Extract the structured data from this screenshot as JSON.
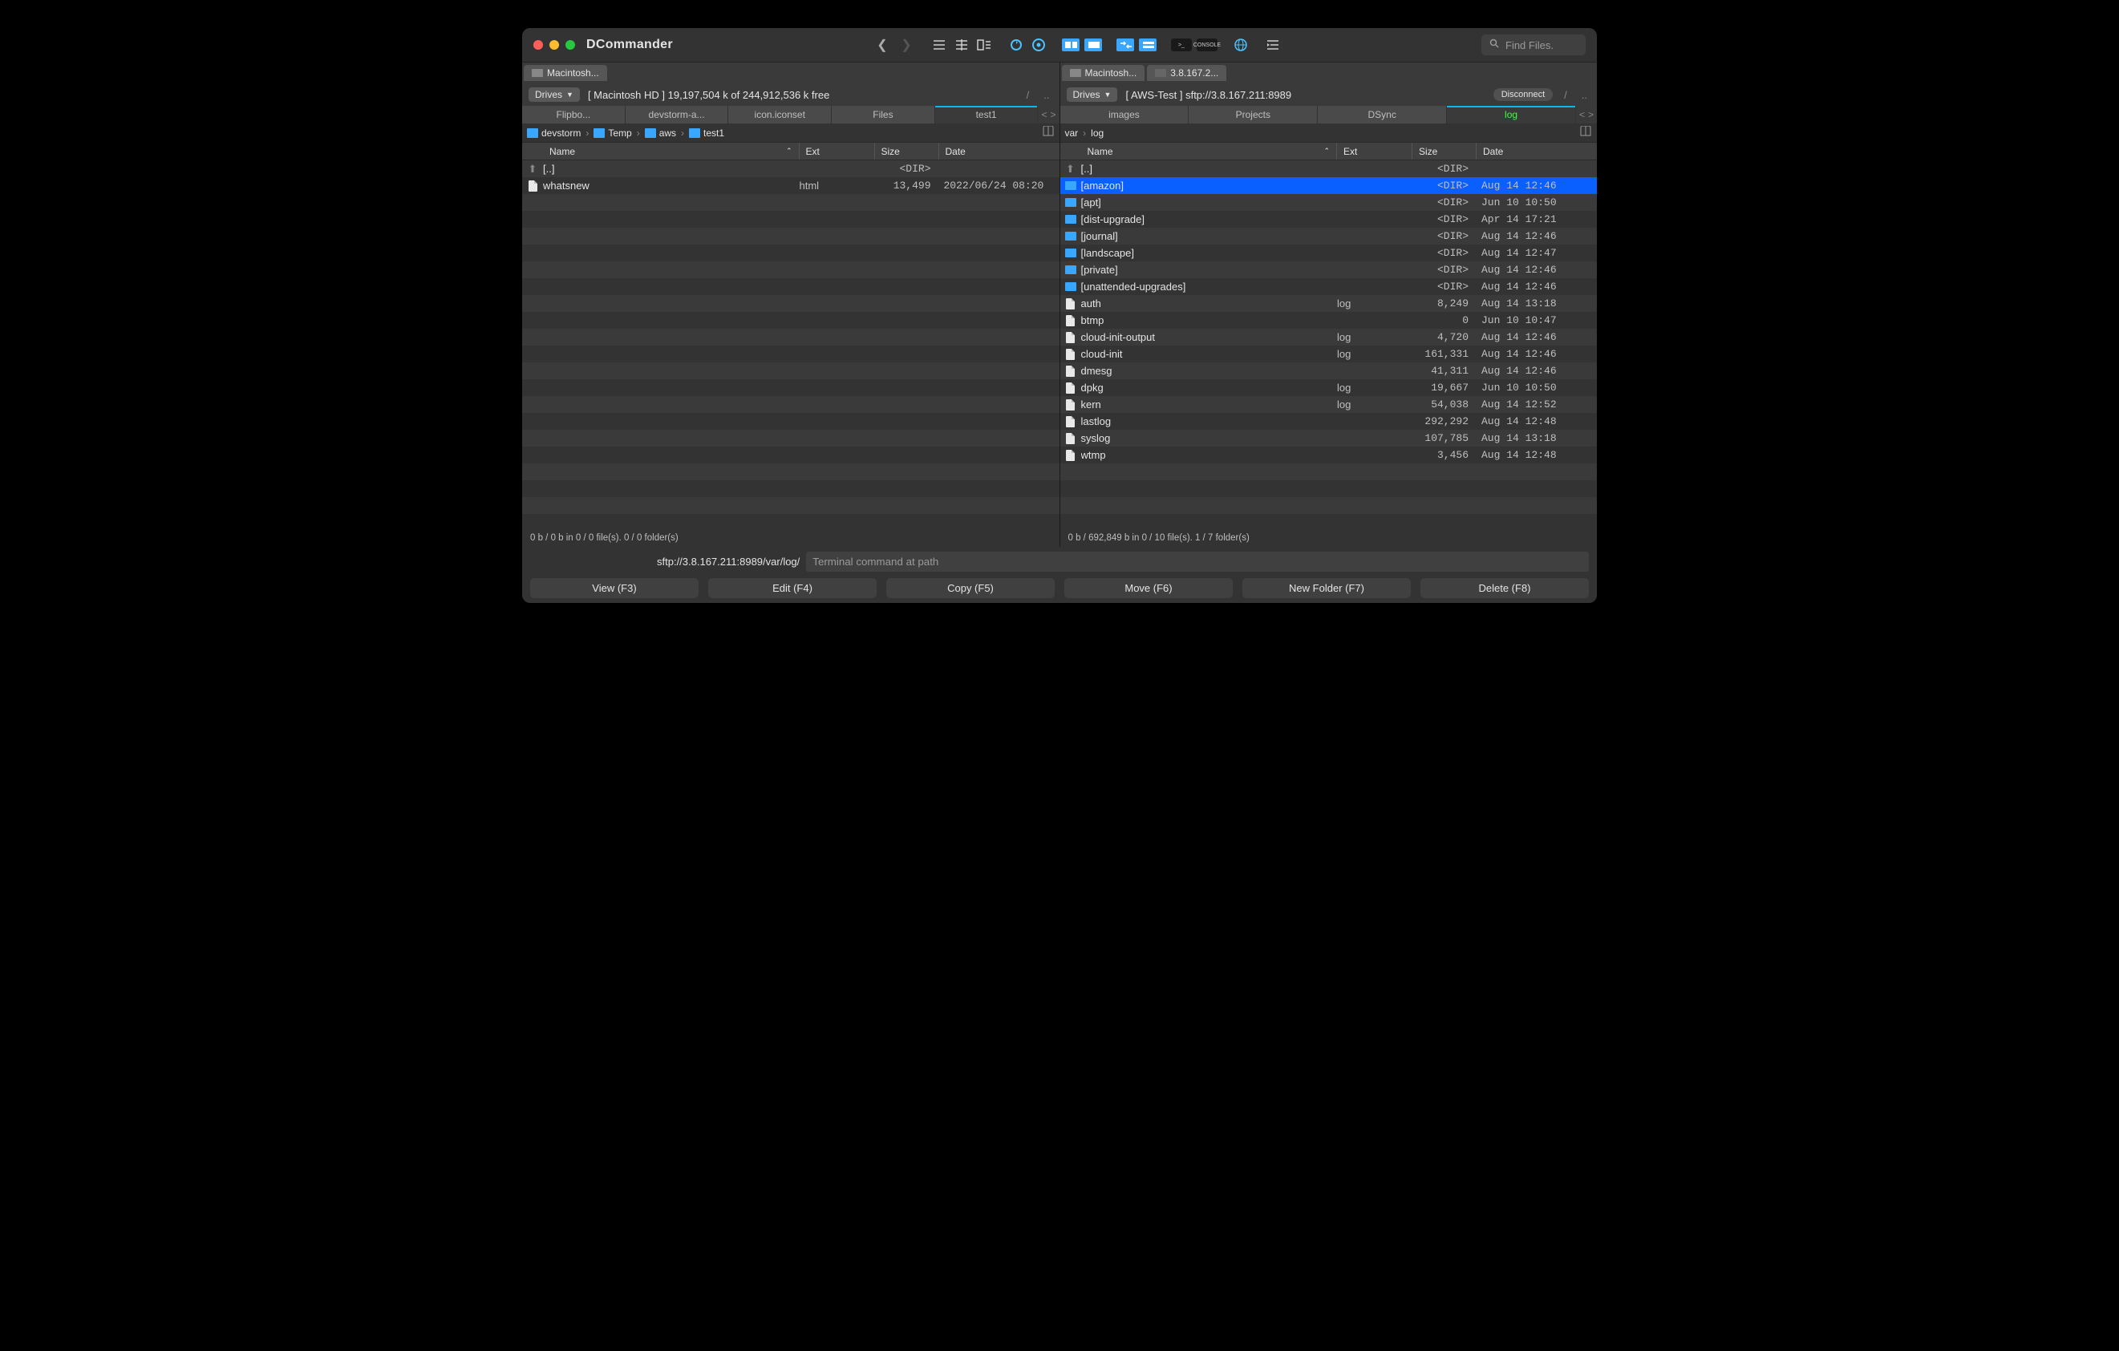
{
  "app_title": "DCommander",
  "search": {
    "placeholder": "Find Files."
  },
  "panes": [
    {
      "drive_tabs": [
        {
          "label": "Macintosh..."
        }
      ],
      "drives_btn": "Drives",
      "drive_info": "[ Macintosh HD ]  19,197,504 k of 244,912,536 k free",
      "disconnect": null,
      "folder_tabs": [
        "Flipbo...",
        "devstorm-a...",
        "icon.iconset",
        "Files",
        "test1"
      ],
      "active_tab": 4,
      "remote": false,
      "crumbs": [
        "devstorm",
        "Temp",
        "aws",
        "test1"
      ],
      "col": {
        "name": "Name",
        "ext": "Ext",
        "size": "Size",
        "date": "Date"
      },
      "rows": [
        {
          "up": true,
          "name": "[..]",
          "ext": "",
          "size": "<DIR>",
          "date": ""
        },
        {
          "type": "file",
          "name": "whatsnew",
          "ext": "html",
          "size": "13,499",
          "date": "2022/06/24 08:20"
        }
      ],
      "fill_rows": 20,
      "status": "0 b / 0 b in 0 / 0 file(s).  0 / 0 folder(s)"
    },
    {
      "drive_tabs": [
        {
          "label": "Macintosh..."
        },
        {
          "label": "3.8.167.2...",
          "net": true
        }
      ],
      "drives_btn": "Drives",
      "drive_info": "[ AWS-Test ] sftp://3.8.167.211:8989",
      "disconnect": "Disconnect",
      "folder_tabs": [
        "images",
        "Projects",
        "DSync",
        "log"
      ],
      "active_tab": 3,
      "remote": true,
      "crumbs": [
        "var",
        "log"
      ],
      "col": {
        "name": "Name",
        "ext": "Ext",
        "size": "Size",
        "date": "Date"
      },
      "rows": [
        {
          "up": true,
          "name": "[..]",
          "ext": "",
          "size": "<DIR>",
          "date": ""
        },
        {
          "type": "dir",
          "name": "[amazon]",
          "ext": "",
          "size": "<DIR>",
          "date": "Aug 14 12:46",
          "selected": true
        },
        {
          "type": "dir",
          "name": "[apt]",
          "ext": "",
          "size": "<DIR>",
          "date": "Jun 10 10:50"
        },
        {
          "type": "dir",
          "name": "[dist-upgrade]",
          "ext": "",
          "size": "<DIR>",
          "date": "Apr 14 17:21"
        },
        {
          "type": "dir",
          "name": "[journal]",
          "ext": "",
          "size": "<DIR>",
          "date": "Aug 14 12:46"
        },
        {
          "type": "dir",
          "name": "[landscape]",
          "ext": "",
          "size": "<DIR>",
          "date": "Aug 14 12:47"
        },
        {
          "type": "dir",
          "name": "[private]",
          "ext": "",
          "size": "<DIR>",
          "date": "Aug 14 12:46"
        },
        {
          "type": "dir",
          "name": "[unattended-upgrades]",
          "ext": "",
          "size": "<DIR>",
          "date": "Aug 14 12:46"
        },
        {
          "type": "file",
          "name": "auth",
          "ext": "log",
          "size": "8,249",
          "date": "Aug 14 13:18"
        },
        {
          "type": "file",
          "name": "btmp",
          "ext": "",
          "size": "0",
          "date": "Jun 10 10:47"
        },
        {
          "type": "file",
          "name": "cloud-init-output",
          "ext": "log",
          "size": "4,720",
          "date": "Aug 14 12:46"
        },
        {
          "type": "file",
          "name": "cloud-init",
          "ext": "log",
          "size": "161,331",
          "date": "Aug 14 12:46"
        },
        {
          "type": "file",
          "name": "dmesg",
          "ext": "",
          "size": "41,311",
          "date": "Aug 14 12:46"
        },
        {
          "type": "file",
          "name": "dpkg",
          "ext": "log",
          "size": "19,667",
          "date": "Jun 10 10:50"
        },
        {
          "type": "file",
          "name": "kern",
          "ext": "log",
          "size": "54,038",
          "date": "Aug 14 12:52"
        },
        {
          "type": "file",
          "name": "lastlog",
          "ext": "",
          "size": "292,292",
          "date": "Aug 14 12:48"
        },
        {
          "type": "file",
          "name": "syslog",
          "ext": "",
          "size": "107,785",
          "date": "Aug 14 13:18"
        },
        {
          "type": "file",
          "name": "wtmp",
          "ext": "",
          "size": "3,456",
          "date": "Aug 14 12:48"
        }
      ],
      "fill_rows": 4,
      "status": "0 b / 692,849 b in 0 / 10 file(s).  1 / 7 folder(s)"
    }
  ],
  "cmd": {
    "path": "sftp://3.8.167.211:8989/var/log/",
    "placeholder": "Terminal command at path"
  },
  "fbuttons": [
    "View (F3)",
    "Edit (F4)",
    "Copy (F5)",
    "Move (F6)",
    "New Folder (F7)",
    "Delete (F8)"
  ]
}
